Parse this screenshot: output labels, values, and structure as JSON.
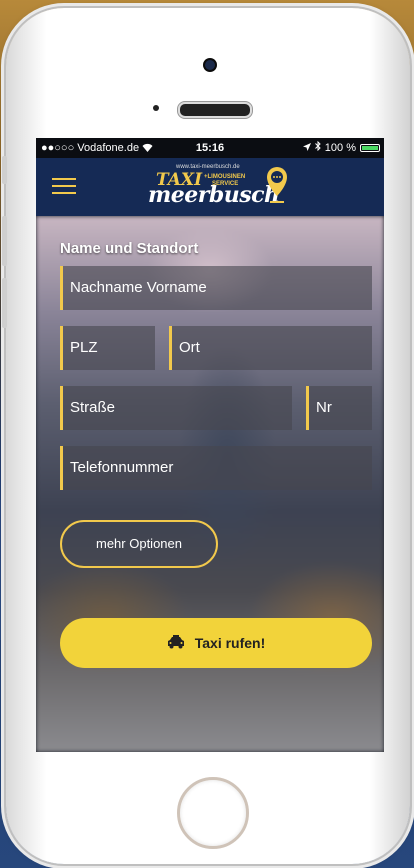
{
  "statusbar": {
    "carrier": "●●○○○ Vodafone.de",
    "time": "15:16",
    "battery": "100 %",
    "battery_level": 1.0
  },
  "header": {
    "logo_url": "www.taxi-meerbusch.de",
    "logo_taxi": "TAXI",
    "logo_limo_line1": "+LIMOUSINEN",
    "logo_limo_line2": "SERVICE",
    "logo_meerbusch": "meerbusch"
  },
  "form": {
    "section_title": "Name und Standort",
    "name_placeholder": "Nachname Vorname",
    "plz_placeholder": "PLZ",
    "ort_placeholder": "Ort",
    "strasse_placeholder": "Straße",
    "nr_placeholder": "Nr",
    "telefon_placeholder": "Telefonnummer"
  },
  "buttons": {
    "more_options": "mehr Optionen",
    "call_taxi": "Taxi rufen!"
  },
  "colors": {
    "accent": "#f2c94c",
    "header_bg": "#152a55",
    "call_button_bg": "#f2d33a"
  },
  "icons": [
    "menu-icon",
    "wifi-icon",
    "location-arrow-icon",
    "bluetooth-icon",
    "battery-icon",
    "taxi-car-icon",
    "location-pin-icon"
  ]
}
